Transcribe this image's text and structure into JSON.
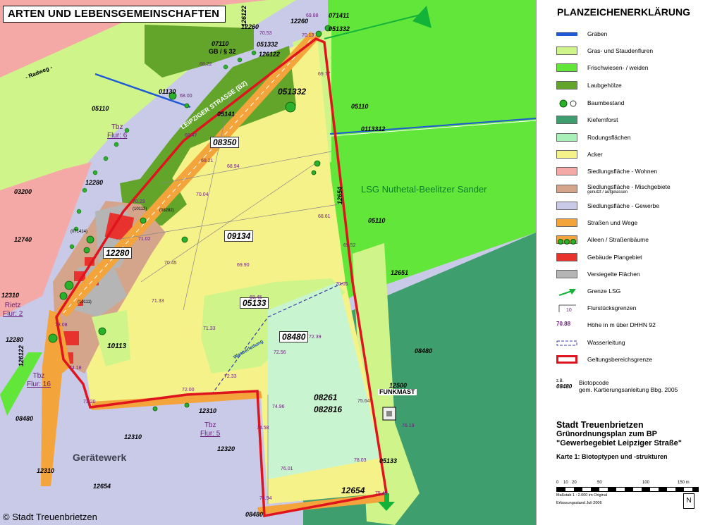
{
  "map": {
    "title": "ARTEN UND LEBENSGEMEINSCHAFTEN",
    "copyright": "© Stadt Treuenbrietzen",
    "street_label": "LEIPZIGER STRASSE (B2)",
    "radweg_label": "- Radweg -",
    "lsg_label": "LSG Nuthetal-Beelitzer Sander",
    "geraetewerk_label": "Gerätewerk",
    "funkmast_label": "FUNKMAST",
    "gb_label": "GB / § 32",
    "wasserleitung_label": "Wasserleitung",
    "flur_labels": [
      {
        "line1": "Tbz",
        "line2": "Flur: 6"
      },
      {
        "line1": "Rietz",
        "line2": "Flur: 2"
      },
      {
        "line1": "Tbz",
        "line2": "Flur: 16"
      },
      {
        "line1": "Tbz",
        "line2": "Flur: 5"
      }
    ],
    "boxed_codes": [
      "051332",
      "08350",
      "09134",
      "12280",
      "05133",
      "08480",
      "08261",
      "082816",
      "12654",
      "10113"
    ],
    "codes": [
      "126122",
      "12260",
      "12260",
      "071411",
      "051332",
      "07110",
      "051332",
      "126122",
      "01130",
      "05110",
      "05141",
      "05110",
      "0113312",
      "12654",
      "05110",
      "03200",
      "12280",
      "12740",
      "12310",
      "12280",
      "126122",
      "08480",
      "12310",
      "12310",
      "12320",
      "12310",
      "12654",
      "08480",
      "12651",
      "08480",
      "12500",
      "05133",
      "(10113)",
      "(08282)",
      "(071414)",
      "(10111)"
    ],
    "heights": [
      "69.88",
      "70.53",
      "70.13",
      "69.77",
      "68.22",
      "68.00",
      "69.47",
      "69.21",
      "70.04",
      "68.94",
      "68.61",
      "69.52",
      "69.90",
      "70.23",
      "70.45",
      "69.45",
      "70.05",
      "71.02",
      "71.33",
      "71.33",
      "72.39",
      "72.33",
      "72.56",
      "73.08",
      "74.18",
      "73.20",
      "72.00",
      "74.58",
      "74.96",
      "75.64",
      "76.19",
      "76.01",
      "78.03",
      "75.45",
      "74.94"
    ]
  },
  "legend": {
    "title": "PLANZEICHENERKLÄRUNG",
    "items": [
      {
        "label": "Gräben",
        "swatch": "line-blue"
      },
      {
        "label": "Gras- und Staudenfluren",
        "swatch": "#cff58a"
      },
      {
        "label": "Frischwiesen- / weiden",
        "swatch": "#63e63a"
      },
      {
        "label": "Laubgehölze",
        "swatch": "#63a52a"
      },
      {
        "label": "Baumbestand",
        "swatch": "tree"
      },
      {
        "label": "Kiefernforst",
        "swatch": "#3e9e6e"
      },
      {
        "label": "Rodungsflächen",
        "swatch": "#a9f0b8"
      },
      {
        "label": "Acker",
        "swatch": "#f6f28a"
      },
      {
        "label": "Siedlungsfläche - Wohnen",
        "swatch": "#f4a9a6"
      },
      {
        "label": "Siedlungsfläche - Mischgebiete",
        "sub": "genutzt / aufgelassen",
        "swatch": "#d4a58a"
      },
      {
        "label": "Siedlungsfläche - Gewerbe",
        "swatch": "#c9c9e8"
      },
      {
        "label": "Straßen und Wege",
        "swatch": "#f3a43a"
      },
      {
        "label": "Alleen / Straßenbäume",
        "swatch": "allee"
      },
      {
        "label": "Gebäude Plangebiet",
        "swatch": "#e8322e"
      },
      {
        "label": "Versiegelte Flächen",
        "swatch": "#b5b5b5"
      },
      {
        "label": "Grenze LSG",
        "swatch": "lsg"
      },
      {
        "label": "Flurstücksgrenzen",
        "swatch": "flur"
      },
      {
        "label": "Höhe in m über DHHN 92",
        "swatch": "70.88"
      },
      {
        "label": "Wasserleitung",
        "swatch": "wasser"
      },
      {
        "label": "Geltungsbereichsgrenze",
        "swatch": "red-border"
      }
    ],
    "biotop_sample_prefix": "z.B.",
    "biotop_sample_code": "08480",
    "biotop_line1": "Biotopcode",
    "biotop_line2": "gem. Kartierungsanleitung Bbg. 2005",
    "stadt": "Stadt Treuenbrietzen",
    "plan_line1": "Grünordnungsplan zum BP",
    "plan_line2": "\"Gewerbegebiet Leipziger Straße\"",
    "karte": "Karte 1: Biotoptypen und -strukturen",
    "scale_ticks": [
      "0",
      "10",
      "20",
      "50",
      "100",
      "150 m"
    ],
    "scale_text": "Maßstab 1 : 2.000 im Original",
    "erfassung": "Erfassungsstand Juli 2006",
    "north": "N"
  },
  "colors": {
    "acker": "#f6f28a",
    "gras": "#cff58a",
    "wiese": "#63e63a",
    "laub": "#63a52a",
    "kiefer": "#3e9e6e",
    "rodung": "#a9f0b8",
    "wohnen": "#f4a9a6",
    "misch": "#d4a58a",
    "gewerbe": "#c9c9e8",
    "strasse": "#f3a43a",
    "gebaeude": "#e8322e",
    "versiegelt": "#b5b5b5",
    "geltung": "#e0141e",
    "graben": "#1f5ad6"
  }
}
